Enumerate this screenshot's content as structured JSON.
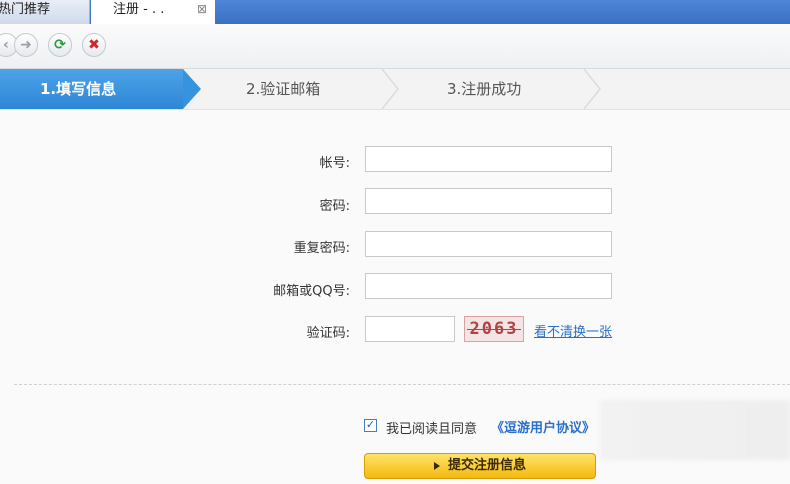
{
  "tabs": [
    {
      "label": "热门推荐"
    },
    {
      "label": "注册 - . .",
      "close": "⊠"
    }
  ],
  "toolbar": {
    "buttons": [
      {
        "icon": "back-arrow-icon",
        "glyph": "➜"
      },
      {
        "icon": "refresh-icon",
        "glyph": "⟳"
      },
      {
        "icon": "stop-icon",
        "glyph": "✖"
      }
    ]
  },
  "steps": [
    {
      "label": "1.填写信息"
    },
    {
      "label": "2.验证邮箱"
    },
    {
      "label": "3.注册成功"
    }
  ],
  "form": {
    "account_label": "帐号:",
    "password_label": "密码:",
    "repeat_password_label": "重复密码:",
    "email_qq_label": "邮箱或QQ号:",
    "captcha_label": "验证码:",
    "captcha_text": "2063",
    "refresh_captcha": "看不清换一张"
  },
  "agreement": {
    "checked_mark": "✓",
    "text": "我已阅读且同意",
    "link": "《逗游用户协议》"
  },
  "submit_label": "提交注册信息",
  "colors": {
    "accent_blue": "#3693dd",
    "link_blue": "#2a6fc9",
    "submit_yellow": "#f3b90e"
  }
}
